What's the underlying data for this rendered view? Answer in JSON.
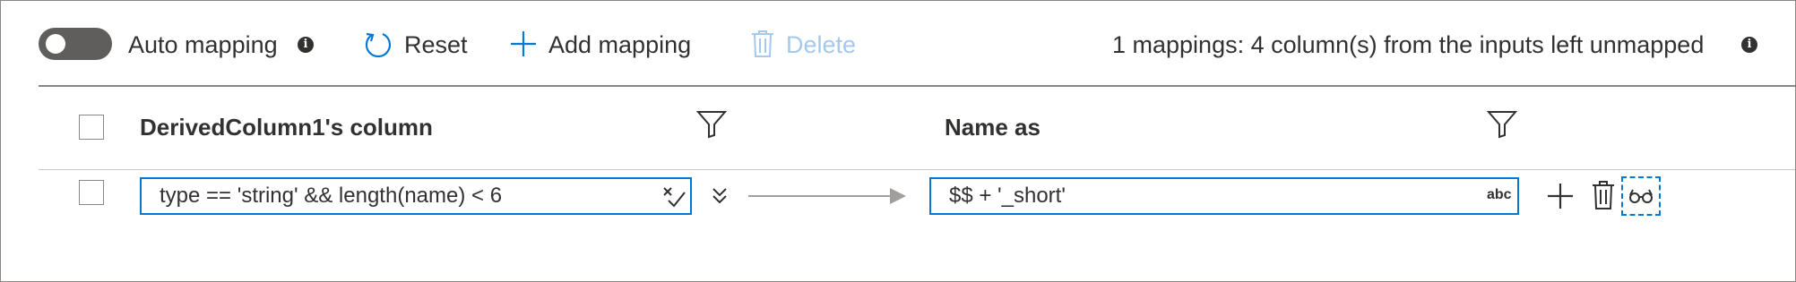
{
  "toolbar": {
    "auto_mapping_label": "Auto mapping",
    "reset_label": "Reset",
    "add_mapping_label": "Add mapping",
    "delete_label": "Delete",
    "status_text": "1 mappings: 4 column(s) from the inputs left unmapped",
    "info_glyph": "i"
  },
  "table": {
    "left_header": "DerivedColumn1's column",
    "right_header": "Name as",
    "rows": [
      {
        "source_expression": "type == 'string' && length(name) < 6",
        "name_as": "$$ + '_short'",
        "type_badge": "abc"
      }
    ]
  },
  "colors": {
    "accent": "#0078d4",
    "toggle_off": "#605e5c",
    "disabled": "#a6c8ec",
    "text": "#323130"
  },
  "icons": [
    "info-icon",
    "reset-icon",
    "plus-icon",
    "trash-icon",
    "filter-icon",
    "expression-clear-icon",
    "expand-chevron-icon",
    "glasses-icon"
  ]
}
